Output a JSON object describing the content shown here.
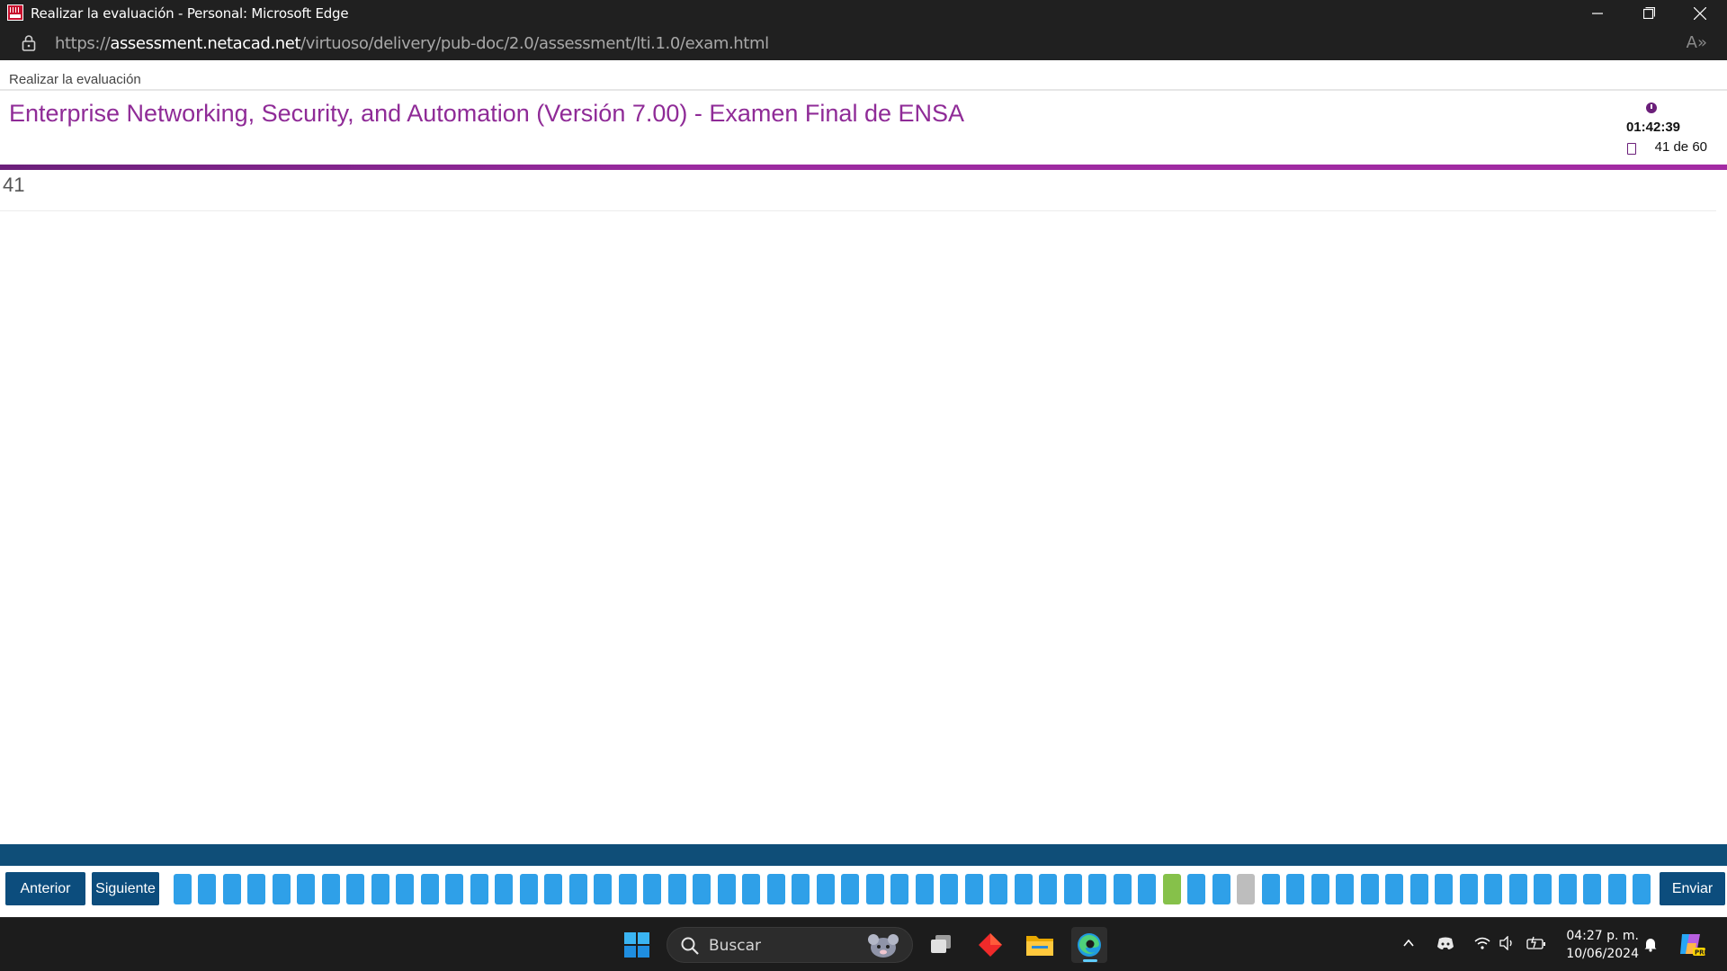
{
  "window": {
    "title": "Realizar la evaluación - Personal: Microsoft Edge"
  },
  "address_bar": {
    "url_prefix": "https://",
    "url_host": "assessment.netacad.net",
    "url_path": "/virtuoso/delivery/pub-doc/2.0/assessment/lti.1.0/exam.html",
    "read_aloud_glyph": "A»"
  },
  "page": {
    "breadcrumb": "Realizar la evaluación",
    "exam_title": "Enterprise Networking, Security, and Automation (Versión 7.00) - Examen Final de ENSA",
    "timer": "01:42:39",
    "progress": "41 de 60",
    "question_number": "41"
  },
  "navigation": {
    "prev_label": "Anterior",
    "next_label": "Siguiente",
    "submit_label": "Enviar",
    "total_questions": 60,
    "current_question": 41,
    "question_states": {
      "41": "current",
      "44": "flagged"
    }
  },
  "taskbar": {
    "search_placeholder": "Buscar",
    "time": "04:27 p. m.",
    "date": "10/06/2024",
    "icons": [
      "windows-start-icon",
      "search-icon",
      "task-view-icon",
      "red-app-icon",
      "file-explorer-icon",
      "edge-icon",
      "chevron-up-icon",
      "discord-icon",
      "wifi-icon",
      "volume-icon",
      "battery-icon",
      "notification-bell-icon",
      "copilot-icon"
    ],
    "colors": {
      "accent": "#60cdff",
      "title_purple": "#8f2b97",
      "question_box": "#2fa0e8",
      "current_box": "#86c14a",
      "flagged_box": "#bdbdbd",
      "nav_blue": "#0c4d7d"
    }
  }
}
